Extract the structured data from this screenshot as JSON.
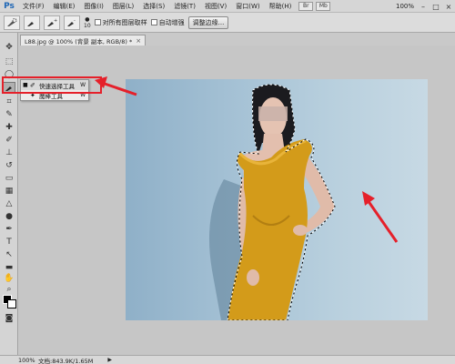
{
  "app": {
    "logo": "Ps"
  },
  "menubar": {
    "items": [
      "文件(F)",
      "编辑(E)",
      "图像(I)",
      "图层(L)",
      "选择(S)",
      "滤镜(T)",
      "视图(V)",
      "窗口(W)",
      "帮助(H)"
    ],
    "mini_buttons": [
      "Br",
      "Mb"
    ],
    "zoom": "100%",
    "window_buttons": [
      "–",
      "□",
      "×"
    ]
  },
  "options": {
    "brush_size": "10",
    "sample_all_layers": "对所有图层取样",
    "auto_enhance": "自动增强",
    "refine_edge": "调整边缘..."
  },
  "document": {
    "tab_title": "L88.jpg @ 100% (背景 副本, RGB/8) *",
    "close": "×"
  },
  "tool_popup": {
    "items": [
      {
        "label": "快速选择工具",
        "shortcut": "W",
        "selected": true
      },
      {
        "label": "魔棒工具",
        "shortcut": "W",
        "selected": false
      }
    ]
  },
  "statusbar": {
    "zoom": "100%",
    "doc_info": "文档:843.9K/1.65M",
    "arrow": "▶"
  },
  "colors": {
    "highlight": "#e5202a",
    "arrow": "#e5202a",
    "dress": "#d39b1a",
    "background": "#a7c3d6"
  },
  "icons": [
    "quick-selection-icon",
    "magic-wand-icon",
    "move-icon",
    "marquee-icon",
    "lasso-icon",
    "crop-icon",
    "eyedropper-icon",
    "brush-icon",
    "stamp-icon",
    "eraser-icon",
    "gradient-icon",
    "pen-icon",
    "type-icon",
    "hand-icon",
    "zoom-icon"
  ]
}
